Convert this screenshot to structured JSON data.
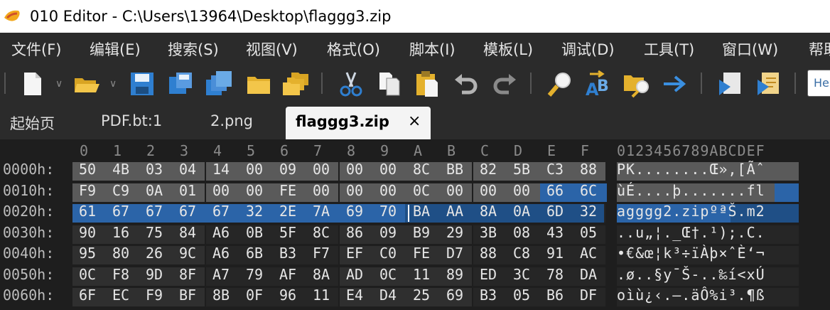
{
  "window": {
    "title": "010 Editor - C:\\Users\\13964\\Desktop\\flaggg3.zip"
  },
  "menu": [
    "文件(F)",
    "编辑(E)",
    "搜索(S)",
    "视图(V)",
    "格式(O)",
    "脚本(I)",
    "模板(L)",
    "调试(D)",
    "工具(T)",
    "窗口(W)",
    "帮助"
  ],
  "toolbar": {
    "icons": [
      "new-file-icon",
      "open-folder-icon",
      "save-icon",
      "save-as-icon",
      "save-all-icon",
      "folder-icon",
      "open-multiple-icon",
      "cut-icon",
      "copy-icon",
      "paste-icon",
      "undo-icon",
      "redo-icon",
      "find-icon",
      "replace-icon",
      "find-in-files-icon",
      "goto-icon",
      "run-script-icon",
      "run-template-icon"
    ],
    "search_text": "He"
  },
  "tabs": {
    "start": "起始页",
    "pdf": "PDF.bt:1",
    "png": "2.png",
    "active": "flaggg3.zip",
    "close": "×"
  },
  "hex": {
    "column_headers": [
      "0",
      "1",
      "2",
      "3",
      "4",
      "5",
      "6",
      "7",
      "8",
      "9",
      "A",
      "B",
      "C",
      "D",
      "E",
      "F"
    ],
    "ascii_header": "0123456789ABCDEF",
    "rows": [
      {
        "addr": "0000h:",
        "bytes": [
          "50",
          "4B",
          "03",
          "04",
          "14",
          "00",
          "09",
          "00",
          "00",
          "00",
          "8C",
          "BB",
          "82",
          "5B",
          "C3",
          "88"
        ],
        "ascii": "PK........Œ»‚[Ãˆ"
      },
      {
        "addr": "0010h:",
        "bytes": [
          "F9",
          "C9",
          "0A",
          "01",
          "00",
          "00",
          "FE",
          "00",
          "00",
          "00",
          "0C",
          "00",
          "00",
          "00",
          "66",
          "6C"
        ],
        "ascii": "ùÉ....þ.......fl"
      },
      {
        "addr": "0020h:",
        "bytes": [
          "61",
          "67",
          "67",
          "67",
          "67",
          "32",
          "2E",
          "7A",
          "69",
          "70",
          "BA",
          "AA",
          "8A",
          "0A",
          "6D",
          "32"
        ],
        "ascii": "agggg2.zipºªŠ.m2"
      },
      {
        "addr": "0030h:",
        "bytes": [
          "90",
          "16",
          "75",
          "84",
          "A6",
          "0B",
          "5F",
          "8C",
          "86",
          "09",
          "B9",
          "29",
          "3B",
          "08",
          "43",
          "05"
        ],
        "ascii": "..u„¦._Œ†.¹);.C."
      },
      {
        "addr": "0040h:",
        "bytes": [
          "95",
          "80",
          "26",
          "9C",
          "A6",
          "6B",
          "B3",
          "F7",
          "EF",
          "C0",
          "FE",
          "D7",
          "88",
          "C8",
          "91",
          "AC"
        ],
        "ascii": "•€&œ¦k³÷ïÀþ×ˆÈ‘¬"
      },
      {
        "addr": "0050h:",
        "bytes": [
          "0C",
          "F8",
          "9D",
          "8F",
          "A7",
          "79",
          "AF",
          "8A",
          "AD",
          "0C",
          "11",
          "89",
          "ED",
          "3C",
          "78",
          "DA"
        ],
        "ascii": ".ø..§y¯Š-..‰í<xÚ"
      },
      {
        "addr": "0060h:",
        "bytes": [
          "6F",
          "EC",
          "F9",
          "BF",
          "8B",
          "0F",
          "96",
          "11",
          "E4",
          "D4",
          "25",
          "69",
          "B3",
          "05",
          "B6",
          "DF"
        ],
        "ascii": "oìù¿‹.–.äÔ%i³.¶ß"
      }
    ]
  },
  "colors": {
    "selection": "#2b64a8",
    "selection_alt": "#1f4f86",
    "gray_block": "#5a5a5a",
    "dark_block": "#2f2f2f"
  }
}
